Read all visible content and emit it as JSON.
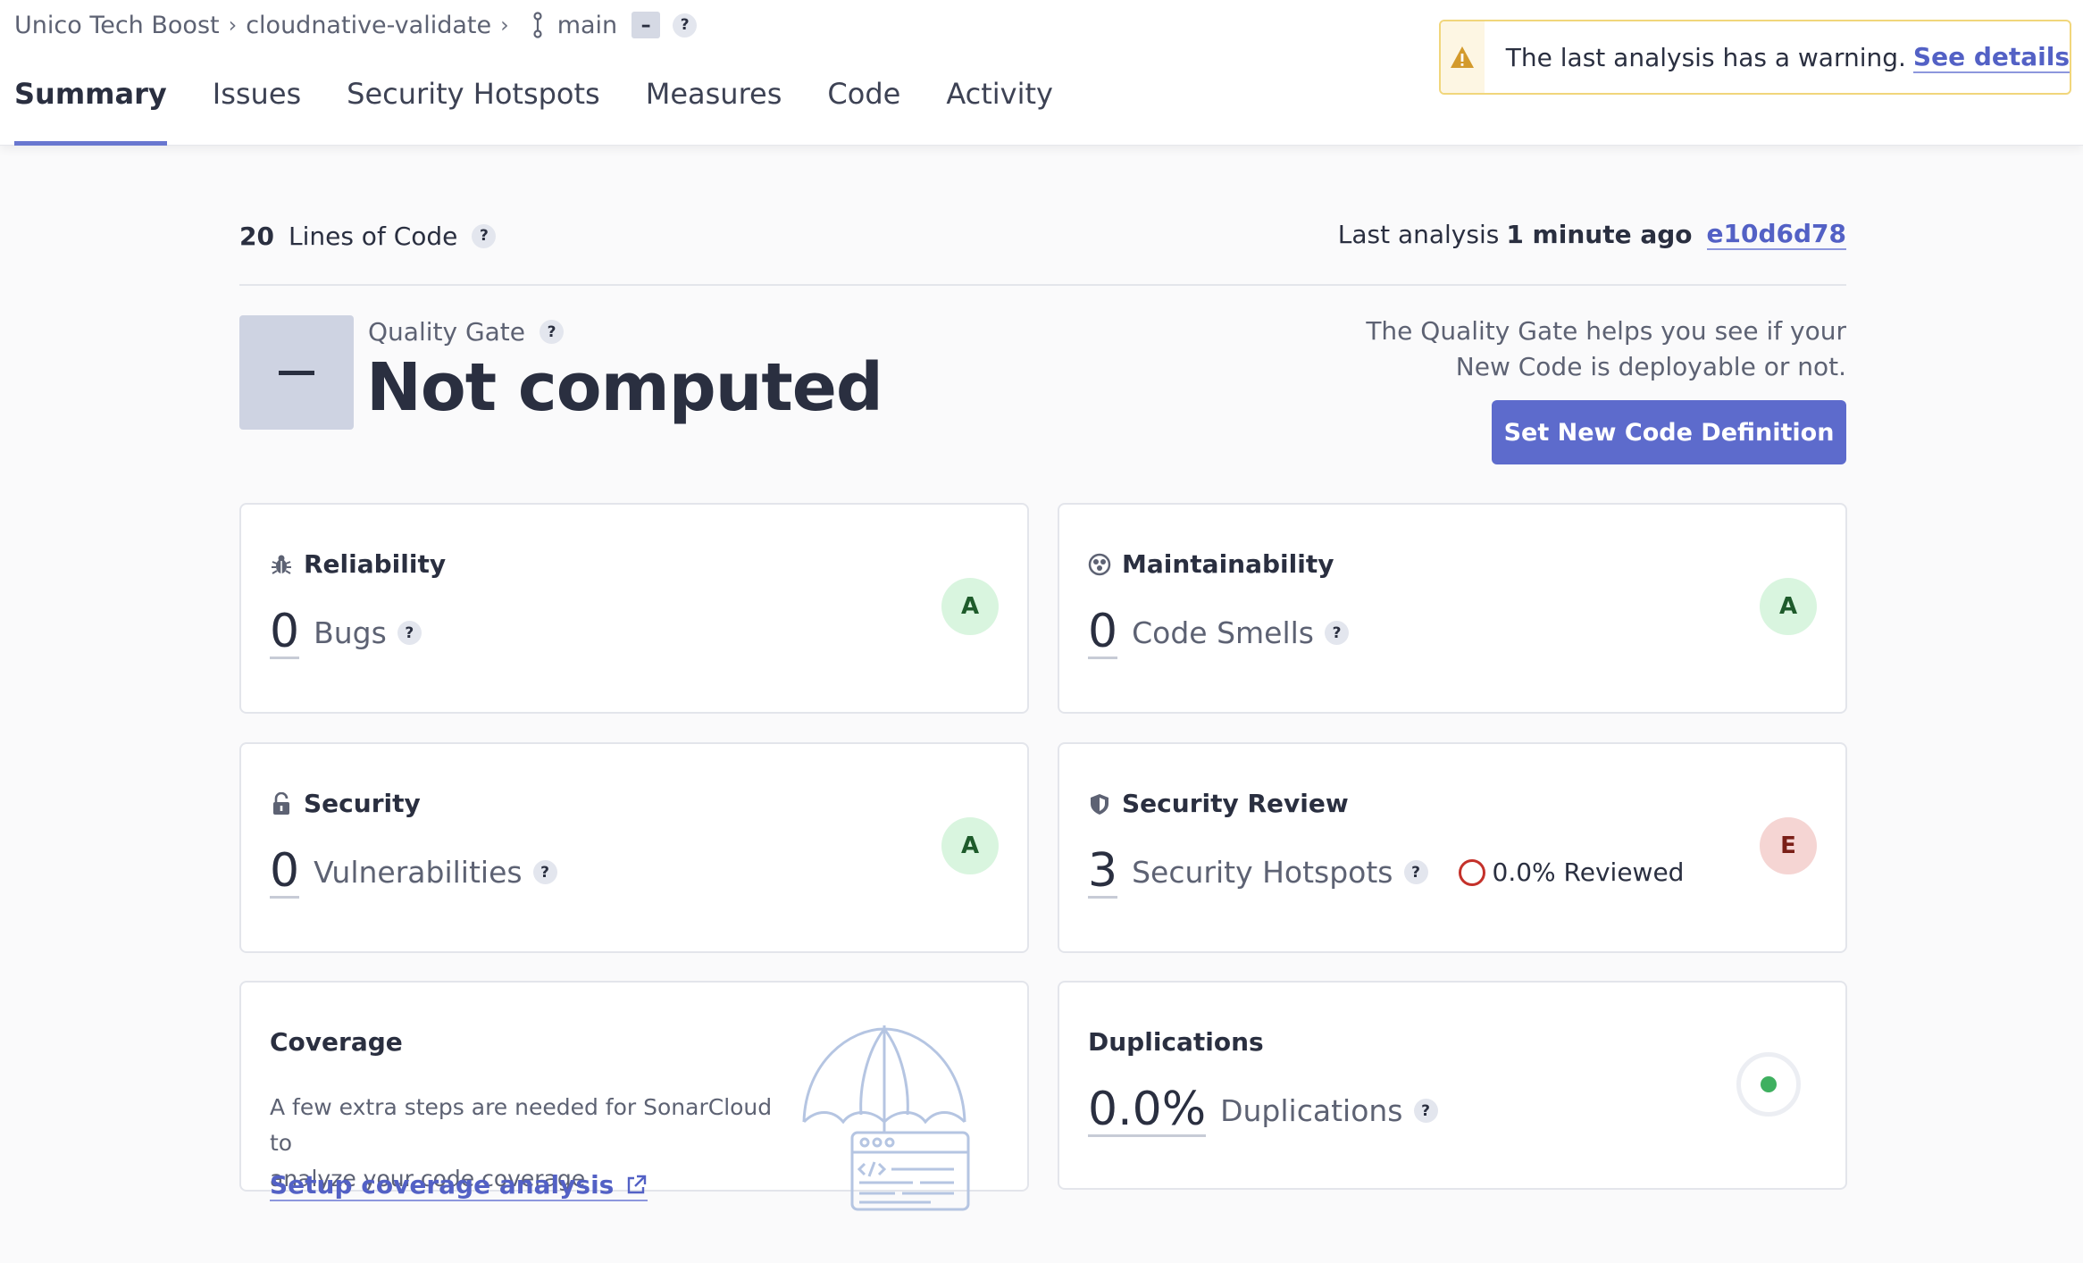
{
  "breadcrumb": {
    "organization": "Unico Tech Boost",
    "project": "cloudnative-validate",
    "branch": "main",
    "branch_status": "–",
    "help": "?"
  },
  "tabs": [
    {
      "label": "Summary",
      "active": true
    },
    {
      "label": "Issues"
    },
    {
      "label": "Security Hotspots"
    },
    {
      "label": "Measures"
    },
    {
      "label": "Code"
    },
    {
      "label": "Activity"
    }
  ],
  "warning": {
    "text": "The last analysis has a warning.",
    "link": "See details"
  },
  "summary": {
    "lines_of_code_value": "20",
    "lines_of_code_label": "Lines of Code",
    "last_analysis_label": "Last analysis",
    "last_analysis_time": "1 minute ago",
    "commit_hash": "e10d6d78"
  },
  "quality_gate": {
    "label": "Quality Gate",
    "status": "Not computed",
    "help_line1": "The Quality Gate helps you see if your",
    "help_line2": "New Code is deployable or not.",
    "button": "Set New Code Definition"
  },
  "cards": {
    "reliability": {
      "title": "Reliability",
      "value": "0",
      "label": "Bugs",
      "rating": "A"
    },
    "maintainability": {
      "title": "Maintainability",
      "value": "0",
      "label": "Code Smells",
      "rating": "A"
    },
    "security": {
      "title": "Security",
      "value": "0",
      "label": "Vulnerabilities",
      "rating": "A"
    },
    "security_review": {
      "title": "Security Review",
      "value": "3",
      "label": "Security Hotspots",
      "reviewed": "0.0% Reviewed",
      "rating": "E"
    },
    "coverage": {
      "title": "Coverage",
      "text_line1": "A few extra steps are needed for SonarCloud to",
      "text_line2": "analyze your code coverage",
      "link": "Setup coverage analysis"
    },
    "duplications": {
      "title": "Duplications",
      "value": "0.0%",
      "label": "Duplications"
    }
  },
  "colors": {
    "accent": "#5d6bcc",
    "rating_a_bg": "#d9f5df",
    "rating_e_bg": "#f5d5d3",
    "warning_border": "#f1d67b"
  },
  "icons": [
    "branch-icon",
    "warning-icon",
    "bug-icon",
    "maintainability-icon",
    "lock-icon",
    "shield-icon",
    "external-link-icon",
    "umbrella-illustration"
  ]
}
